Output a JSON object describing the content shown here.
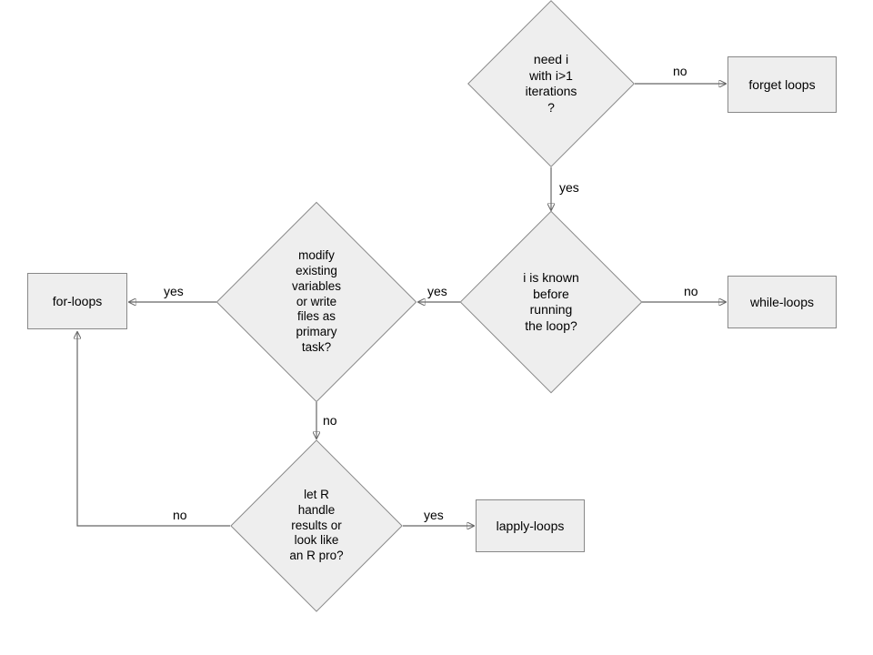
{
  "nodes": {
    "d1": "need i\nwith i>1\niterations\n?",
    "d2": "i is known\nbefore\nrunning\nthe loop?",
    "d3": "modify\nexisting\nvariables\nor  write\nfiles as\nprimary\ntask?",
    "d4": "let R\nhandle\nresults or\nlook like\nan R pro?",
    "r_forget": "forget loops",
    "r_while": "while-loops",
    "r_for": "for-loops",
    "r_lapply": "lapply-loops"
  },
  "labels": {
    "d1_no": "no",
    "d1_yes": "yes",
    "d2_no": "no",
    "d2_yes": "yes",
    "d3_no": "no",
    "d3_yes": "yes",
    "d4_no": "no",
    "d4_yes": "yes"
  }
}
